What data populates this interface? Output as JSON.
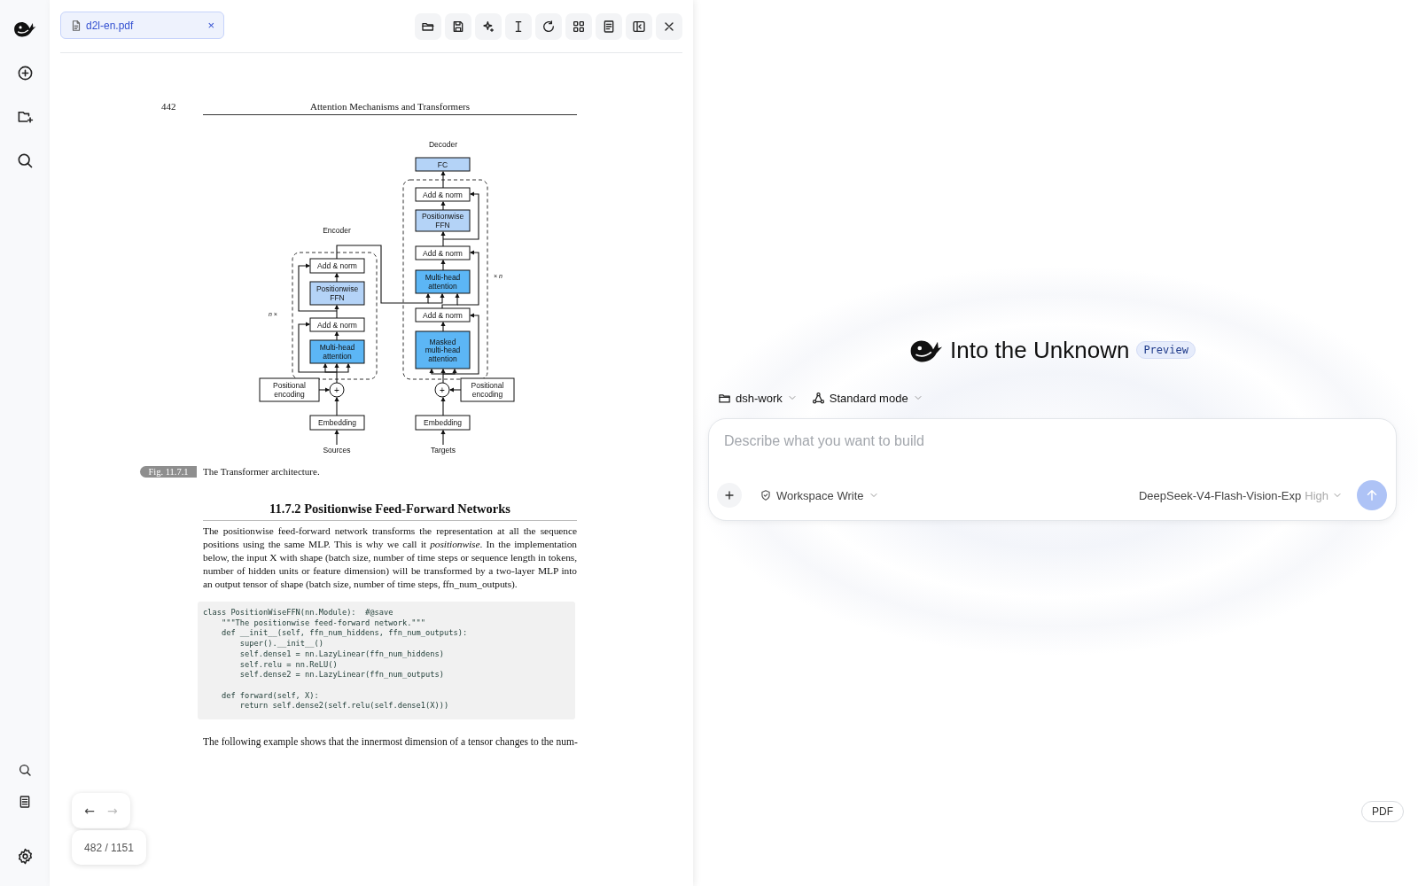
{
  "document_tab": {
    "name": "d2l-en.pdf",
    "close": "×"
  },
  "pdf_page": {
    "page_number": "442",
    "running_title": "Attention Mechanisms and Transformers",
    "figure": {
      "labels": [
        "Decoder",
        "Encoder",
        "× n",
        "n ×",
        "Sources",
        "Targets"
      ],
      "nodes": [
        {
          "kind": "output",
          "lines": [
            "FC"
          ]
        },
        {
          "kind": "plain",
          "lines": [
            "Add & norm"
          ]
        },
        {
          "kind": "ffn",
          "lines": [
            "Positionwise",
            "FFN"
          ]
        },
        {
          "kind": "plain",
          "lines": [
            "Add & norm"
          ]
        },
        {
          "kind": "plain",
          "lines": [
            "Add & norm"
          ]
        },
        {
          "kind": "ffn",
          "lines": [
            "Positionwise",
            "FFN"
          ]
        },
        {
          "kind": "attn",
          "lines": [
            "Multi-head",
            "attention"
          ]
        },
        {
          "kind": "plain",
          "lines": [
            "Add & norm"
          ]
        },
        {
          "kind": "plain",
          "lines": [
            "Add & norm"
          ]
        },
        {
          "kind": "attn",
          "lines": [
            "Multi-head",
            "attention"
          ]
        },
        {
          "kind": "attn",
          "lines": [
            "Masked",
            "multi-head",
            "attention"
          ]
        },
        {
          "kind": "plain",
          "lines": [
            "Positional",
            "encoding"
          ]
        },
        {
          "kind": "sum",
          "lines": [
            "+"
          ]
        },
        {
          "kind": "sum",
          "lines": [
            "+"
          ]
        },
        {
          "kind": "plain",
          "lines": [
            "Positional",
            "encoding"
          ]
        },
        {
          "kind": "plain",
          "lines": [
            "Embedding"
          ]
        },
        {
          "kind": "plain",
          "lines": [
            "Embedding"
          ]
        }
      ],
      "caption_tag": "Fig. 11.7.1",
      "caption": "The Transformer architecture."
    },
    "section_heading": "11.7.2 Positionwise Feed-Forward Networks",
    "paragraph": "The positionwise feed-forward network transforms the representation at all the sequence positions using the same MLP. This is why we call it *positionwise*. In the implementation below, the input X with shape (batch size, number of time steps or sequence length in tokens, number of hidden units or feature dimension) will be transformed by a two-layer MLP into an output tensor of shape (batch size, number of time steps, ffn_num_outputs).",
    "code": "class PositionWiseFFN(nn.Module):  #@save\n    \"\"\"The positionwise feed-forward network.\"\"\"\n    def __init__(self, ffn_num_hiddens, ffn_num_outputs):\n        super().__init__()\n        self.dense1 = nn.LazyLinear(ffn_num_hiddens)\n        self.relu = nn.ReLU()\n        self.dense2 = nn.LazyLinear(ffn_num_outputs)\n\n    def forward(self, X):\n        return self.dense2(self.relu(self.dense1(X)))",
    "trailing_text": "The following example shows that the innermost dimension of a tensor changes to the num-"
  },
  "pager": {
    "prev": {
      "label": "←",
      "disabled": false
    },
    "next": {
      "label": "→",
      "disabled": true
    },
    "page_indicator": "482 / 1151"
  },
  "composer": {
    "title": "Into the Unknown",
    "badge": "Preview",
    "workspace": "dsh-work",
    "mode": "Standard mode",
    "placeholder": "Describe what you want to build",
    "permission": "Workspace Write",
    "model": "DeepSeek-V4-Flash-Vision-Exp",
    "effort": "High",
    "send_disabled": true
  },
  "pdf_toggle": "PDF"
}
